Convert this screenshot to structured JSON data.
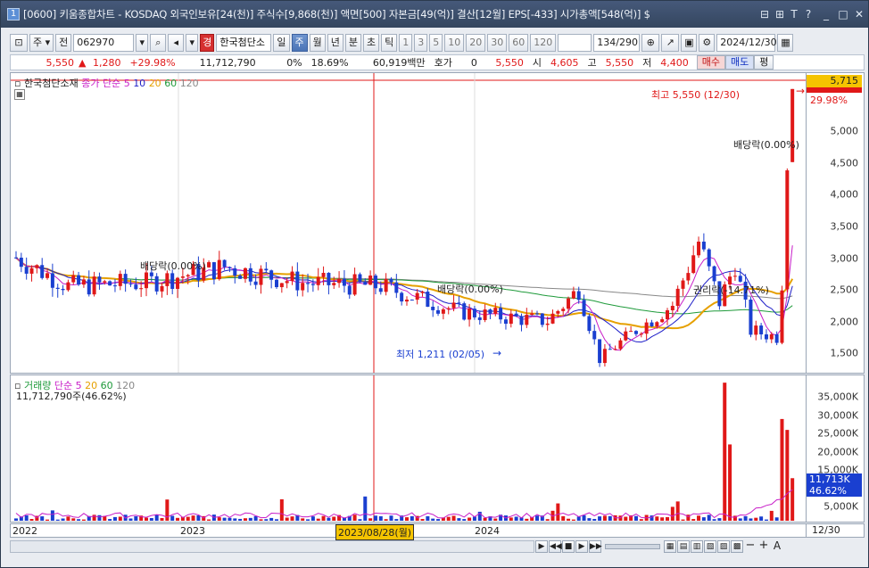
{
  "title": {
    "num": "1",
    "text": "[0600] 키움종합차트 - KOSDAQ 외국인보유[24(천)] 주식수[9,868(천)] 액면[500] 자본금[49(억)] 결산[12월] EPS[-433] 시가총액[548(억)] $"
  },
  "toolbar": {
    "period_week": "주",
    "jeon": "전",
    "code": "062970",
    "stock_name": "한국첨단소",
    "stock_badge": "경",
    "tf_il": "일",
    "tf_ju": "주",
    "tf_wol": "월",
    "tf_nyeon": "년",
    "tf_bun": "분",
    "tf_cho": "초",
    "tf_tick": "틱",
    "nums": [
      "1",
      "3",
      "5",
      "10",
      "20",
      "30",
      "60",
      "120"
    ],
    "count": "134/290",
    "date": "2024/12/30"
  },
  "ticker": {
    "price": "5,550",
    "change": "1,280",
    "change_pct": "+29.98%",
    "volume": "11,712,790",
    "pct0": "0%",
    "pct1": "18.69%",
    "amount": "60,919백만",
    "hoga_label": "호가",
    "hoga_val": "0",
    "hoga_price": "5,550",
    "si_label": "시",
    "si_val": "4,605",
    "go_label": "고",
    "go_val": "5,550",
    "jeo_label": "저",
    "jeo_val": "4,400",
    "buy": "매수",
    "sell": "매도",
    "flat": "평"
  },
  "price_panel": {
    "legend_name": "한국첨단소재",
    "legend_ma_label": "종가 단순",
    "ma_periods": [
      "5",
      "10",
      "20",
      "60",
      "120"
    ],
    "current_label": "5,715",
    "current_pct": "29.98%",
    "annotations": {
      "high": "최고 5,550 (12/30)",
      "low": "최저 1,211 (02/05)",
      "div1": "배당락(0.00%)",
      "div2": "배당락(0.00%)",
      "div3": "배당락(0.00%)",
      "rights": "권리락(-14.71%)"
    },
    "y_ticks": [
      "5,000",
      "4,500",
      "4,000",
      "3,500",
      "3,000",
      "2,500",
      "2,000",
      "1,500"
    ]
  },
  "volume_panel": {
    "legend_name": "거래량",
    "legend_ma_label": "단순",
    "ma_periods": [
      "5",
      "20",
      "60",
      "120"
    ],
    "value_line": "11,712,790주(46.62%)",
    "current_label": "11,713K",
    "current_pct": "46.62%",
    "y_ticks": [
      "35,000K",
      "30,000K",
      "25,000K",
      "20,000K",
      "15,000K",
      "10,000K",
      "5,000K"
    ]
  },
  "x_axis": {
    "labels": [
      "2022",
      "2023",
      "2024"
    ],
    "cursor_date": "2023/08/28(월)",
    "right_label": "12/30"
  },
  "colors": {
    "up": "#e01818",
    "down": "#1a3fd0",
    "ma5": "#c81ec8",
    "ma10": "#1e1ec8",
    "ma20": "#e6a000",
    "ma60": "#1e9a3a",
    "ma120": "#888888"
  },
  "chart_data": {
    "type": "candlestick",
    "series_name": "한국첨단소재",
    "x_labels": [
      "2022",
      "2023",
      "2024"
    ],
    "ylim": [
      1100,
      5800
    ],
    "high": 5550,
    "low": 1211,
    "close_last": 5550,
    "volume_last": 11712790,
    "volume_ylim": [
      0,
      40000000
    ]
  }
}
